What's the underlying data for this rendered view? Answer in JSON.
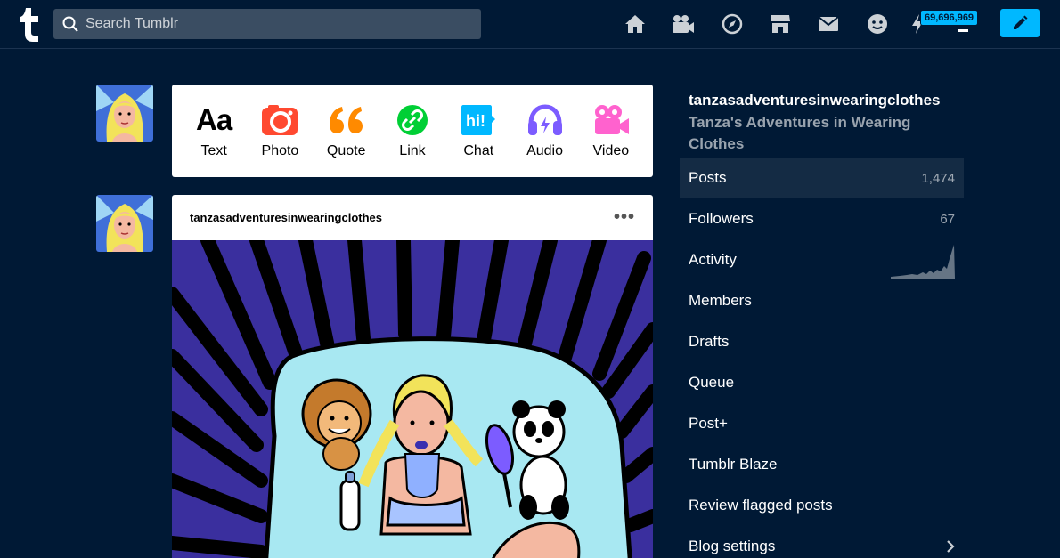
{
  "header": {
    "search_placeholder": "Search Tumblr",
    "icons": [
      "home-icon",
      "video-icon",
      "explore-icon",
      "shop-icon",
      "inbox-icon",
      "messaging-icon",
      "activity-icon",
      "account-icon"
    ],
    "notification_count": "69,696,969",
    "accent": "#00b8ff"
  },
  "composer": {
    "types": [
      {
        "label": "Text",
        "icon": "text-icon"
      },
      {
        "label": "Photo",
        "icon": "photo-icon",
        "color": "#ff4930"
      },
      {
        "label": "Quote",
        "icon": "quote-icon",
        "color": "#ff8a00"
      },
      {
        "label": "Link",
        "icon": "link-icon",
        "color": "#00cf35"
      },
      {
        "label": "Chat",
        "icon": "chat-icon",
        "color": "#00b8ff"
      },
      {
        "label": "Audio",
        "icon": "audio-icon",
        "color": "#7c5cff"
      },
      {
        "label": "Video",
        "icon": "video-icon",
        "color": "#ff62ce"
      }
    ]
  },
  "post": {
    "username": "tanzasadventuresinwearingclothes",
    "menu": "•••"
  },
  "sidebar": {
    "blog_name": "tanzasadventuresinwearingclothes",
    "blog_title": "Tanza's Adventures in Wearing Clothes",
    "items": [
      {
        "label": "Posts",
        "count": "1,474"
      },
      {
        "label": "Followers",
        "count": "67"
      },
      {
        "label": "Activity"
      },
      {
        "label": "Members"
      },
      {
        "label": "Drafts"
      },
      {
        "label": "Queue"
      },
      {
        "label": "Post+"
      },
      {
        "label": "Tumblr Blaze"
      },
      {
        "label": "Review flagged posts"
      },
      {
        "label": "Blog settings"
      }
    ]
  }
}
